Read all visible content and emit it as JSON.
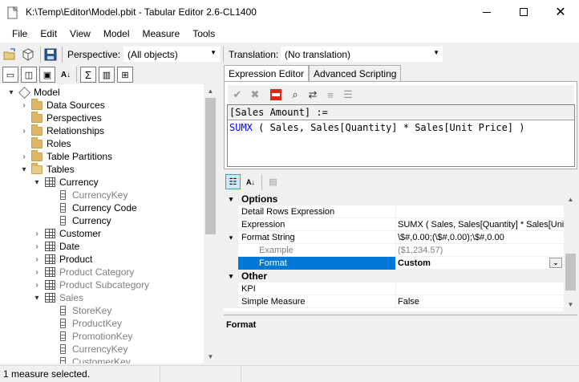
{
  "window": {
    "title": "K:\\Temp\\Editor\\Model.pbit - Tabular Editor 2.6-CL1400"
  },
  "menu": [
    "File",
    "Edit",
    "View",
    "Model",
    "Measure",
    "Tools"
  ],
  "toolbar": {
    "perspective_label": "Perspective:",
    "perspective_value": "(All objects)",
    "translation_label": "Translation:",
    "translation_value": "(No translation)"
  },
  "tree": {
    "items": [
      {
        "label": "Model",
        "icon": "cube-icon",
        "level": 0,
        "exp": "▾",
        "grey": false
      },
      {
        "label": "Data Sources",
        "icon": "folder-icon",
        "level": 1,
        "exp": "›",
        "grey": false
      },
      {
        "label": "Perspectives",
        "icon": "folder-icon",
        "level": 1,
        "exp": "",
        "grey": false
      },
      {
        "label": "Relationships",
        "icon": "folder-icon",
        "level": 1,
        "exp": "›",
        "grey": false
      },
      {
        "label": "Roles",
        "icon": "folder-icon",
        "level": 1,
        "exp": "",
        "grey": false
      },
      {
        "label": "Table Partitions",
        "icon": "folder-icon",
        "level": 1,
        "exp": "›",
        "grey": false
      },
      {
        "label": "Tables",
        "icon": "folder-open-icon",
        "level": 1,
        "exp": "▾",
        "grey": false
      },
      {
        "label": "Currency",
        "icon": "table-icon",
        "level": 2,
        "exp": "▾",
        "grey": false
      },
      {
        "label": "CurrencyKey",
        "icon": "column-icon",
        "level": 3,
        "exp": "",
        "grey": true
      },
      {
        "label": "Currency Code",
        "icon": "column-icon",
        "level": 3,
        "exp": "",
        "grey": false
      },
      {
        "label": "Currency",
        "icon": "column-icon",
        "level": 3,
        "exp": "",
        "grey": false
      },
      {
        "label": "Customer",
        "icon": "table-icon",
        "level": 2,
        "exp": "›",
        "grey": false
      },
      {
        "label": "Date",
        "icon": "table-icon",
        "level": 2,
        "exp": "›",
        "grey": false
      },
      {
        "label": "Product",
        "icon": "table-icon",
        "level": 2,
        "exp": "›",
        "grey": false
      },
      {
        "label": "Product Category",
        "icon": "table-icon",
        "level": 2,
        "exp": "›",
        "grey": true
      },
      {
        "label": "Product Subcategory",
        "icon": "table-icon",
        "level": 2,
        "exp": "›",
        "grey": true
      },
      {
        "label": "Sales",
        "icon": "table-icon",
        "level": 2,
        "exp": "▾",
        "grey": true
      },
      {
        "label": "StoreKey",
        "icon": "column-icon",
        "level": 3,
        "exp": "",
        "grey": true
      },
      {
        "label": "ProductKey",
        "icon": "column-icon",
        "level": 3,
        "exp": "",
        "grey": true
      },
      {
        "label": "PromotionKey",
        "icon": "column-icon",
        "level": 3,
        "exp": "",
        "grey": true
      },
      {
        "label": "CurrencyKey",
        "icon": "column-icon",
        "level": 3,
        "exp": "",
        "grey": true
      },
      {
        "label": "CustomerKey",
        "icon": "column-icon",
        "level": 3,
        "exp": "",
        "grey": true
      }
    ]
  },
  "tabs": [
    "Expression Editor",
    "Advanced Scripting"
  ],
  "editor": {
    "header": "[Sales Amount] :=",
    "func": "SUMX",
    "expr_rest": " ( Sales, Sales[Quantity] * Sales[Unit Price] )"
  },
  "props": {
    "rows": [
      {
        "type": "cat",
        "name": "Options",
        "exp": "▾"
      },
      {
        "type": "prop",
        "name": "Detail Rows Expression",
        "value": ""
      },
      {
        "type": "prop",
        "name": "Expression",
        "value": "SUMX ( Sales, Sales[Quantity] * Sales[Unit P"
      },
      {
        "type": "prop",
        "name": "Format String",
        "value": "\\$#,0.00;(\\$#,0.00);\\$#,0.00",
        "exp": "▾"
      },
      {
        "type": "sub",
        "name": "Example",
        "value": "($1,234.57)"
      },
      {
        "type": "sel",
        "name": "Format",
        "value": "Custom"
      },
      {
        "type": "cat",
        "name": "Other",
        "exp": "▾"
      },
      {
        "type": "prop",
        "name": "KPI",
        "value": ""
      },
      {
        "type": "prop",
        "name": "Simple Measure",
        "value": "False"
      }
    ]
  },
  "description": {
    "title": "Format"
  },
  "status": {
    "text": "1 measure selected."
  }
}
